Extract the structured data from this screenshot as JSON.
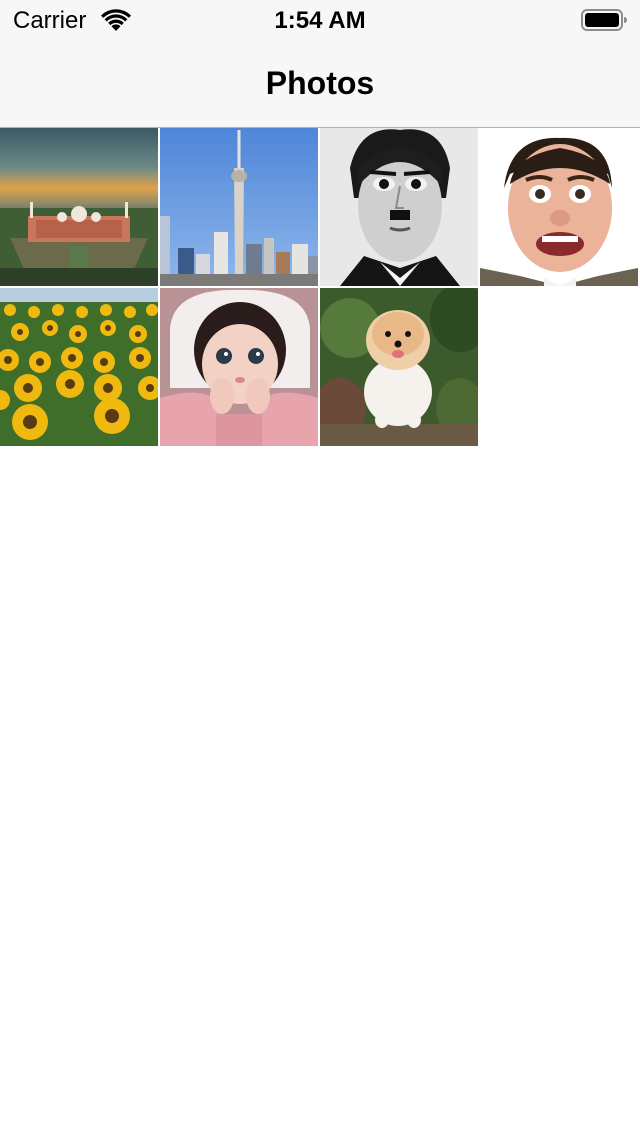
{
  "status_bar": {
    "carrier": "Carrier",
    "time": "1:54 AM",
    "wifi_icon": "wifi-icon",
    "battery_icon": "battery-icon"
  },
  "nav_bar": {
    "title": "Photos"
  },
  "photos": [
    {
      "subject": "mosque-aerial"
    },
    {
      "subject": "tower-skyline"
    },
    {
      "subject": "mustache-portrait"
    },
    {
      "subject": "surprised-man-portrait"
    },
    {
      "subject": "sunflower-field"
    },
    {
      "subject": "child-in-pink"
    },
    {
      "subject": "pomeranian-dog"
    }
  ]
}
